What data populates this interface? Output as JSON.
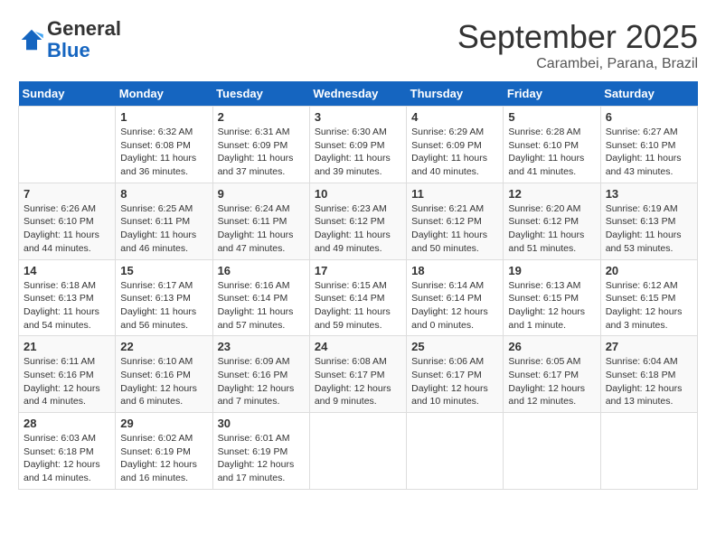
{
  "header": {
    "logo_general": "General",
    "logo_blue": "Blue",
    "month": "September 2025",
    "location": "Carambei, Parana, Brazil"
  },
  "days_of_week": [
    "Sunday",
    "Monday",
    "Tuesday",
    "Wednesday",
    "Thursday",
    "Friday",
    "Saturday"
  ],
  "weeks": [
    [
      {
        "day": "",
        "sunrise": "",
        "sunset": "",
        "daylight": ""
      },
      {
        "day": "1",
        "sunrise": "Sunrise: 6:32 AM",
        "sunset": "Sunset: 6:08 PM",
        "daylight": "Daylight: 11 hours and 36 minutes."
      },
      {
        "day": "2",
        "sunrise": "Sunrise: 6:31 AM",
        "sunset": "Sunset: 6:09 PM",
        "daylight": "Daylight: 11 hours and 37 minutes."
      },
      {
        "day": "3",
        "sunrise": "Sunrise: 6:30 AM",
        "sunset": "Sunset: 6:09 PM",
        "daylight": "Daylight: 11 hours and 39 minutes."
      },
      {
        "day": "4",
        "sunrise": "Sunrise: 6:29 AM",
        "sunset": "Sunset: 6:09 PM",
        "daylight": "Daylight: 11 hours and 40 minutes."
      },
      {
        "day": "5",
        "sunrise": "Sunrise: 6:28 AM",
        "sunset": "Sunset: 6:10 PM",
        "daylight": "Daylight: 11 hours and 41 minutes."
      },
      {
        "day": "6",
        "sunrise": "Sunrise: 6:27 AM",
        "sunset": "Sunset: 6:10 PM",
        "daylight": "Daylight: 11 hours and 43 minutes."
      }
    ],
    [
      {
        "day": "7",
        "sunrise": "Sunrise: 6:26 AM",
        "sunset": "Sunset: 6:10 PM",
        "daylight": "Daylight: 11 hours and 44 minutes."
      },
      {
        "day": "8",
        "sunrise": "Sunrise: 6:25 AM",
        "sunset": "Sunset: 6:11 PM",
        "daylight": "Daylight: 11 hours and 46 minutes."
      },
      {
        "day": "9",
        "sunrise": "Sunrise: 6:24 AM",
        "sunset": "Sunset: 6:11 PM",
        "daylight": "Daylight: 11 hours and 47 minutes."
      },
      {
        "day": "10",
        "sunrise": "Sunrise: 6:23 AM",
        "sunset": "Sunset: 6:12 PM",
        "daylight": "Daylight: 11 hours and 49 minutes."
      },
      {
        "day": "11",
        "sunrise": "Sunrise: 6:21 AM",
        "sunset": "Sunset: 6:12 PM",
        "daylight": "Daylight: 11 hours and 50 minutes."
      },
      {
        "day": "12",
        "sunrise": "Sunrise: 6:20 AM",
        "sunset": "Sunset: 6:12 PM",
        "daylight": "Daylight: 11 hours and 51 minutes."
      },
      {
        "day": "13",
        "sunrise": "Sunrise: 6:19 AM",
        "sunset": "Sunset: 6:13 PM",
        "daylight": "Daylight: 11 hours and 53 minutes."
      }
    ],
    [
      {
        "day": "14",
        "sunrise": "Sunrise: 6:18 AM",
        "sunset": "Sunset: 6:13 PM",
        "daylight": "Daylight: 11 hours and 54 minutes."
      },
      {
        "day": "15",
        "sunrise": "Sunrise: 6:17 AM",
        "sunset": "Sunset: 6:13 PM",
        "daylight": "Daylight: 11 hours and 56 minutes."
      },
      {
        "day": "16",
        "sunrise": "Sunrise: 6:16 AM",
        "sunset": "Sunset: 6:14 PM",
        "daylight": "Daylight: 11 hours and 57 minutes."
      },
      {
        "day": "17",
        "sunrise": "Sunrise: 6:15 AM",
        "sunset": "Sunset: 6:14 PM",
        "daylight": "Daylight: 11 hours and 59 minutes."
      },
      {
        "day": "18",
        "sunrise": "Sunrise: 6:14 AM",
        "sunset": "Sunset: 6:14 PM",
        "daylight": "Daylight: 12 hours and 0 minutes."
      },
      {
        "day": "19",
        "sunrise": "Sunrise: 6:13 AM",
        "sunset": "Sunset: 6:15 PM",
        "daylight": "Daylight: 12 hours and 1 minute."
      },
      {
        "day": "20",
        "sunrise": "Sunrise: 6:12 AM",
        "sunset": "Sunset: 6:15 PM",
        "daylight": "Daylight: 12 hours and 3 minutes."
      }
    ],
    [
      {
        "day": "21",
        "sunrise": "Sunrise: 6:11 AM",
        "sunset": "Sunset: 6:16 PM",
        "daylight": "Daylight: 12 hours and 4 minutes."
      },
      {
        "day": "22",
        "sunrise": "Sunrise: 6:10 AM",
        "sunset": "Sunset: 6:16 PM",
        "daylight": "Daylight: 12 hours and 6 minutes."
      },
      {
        "day": "23",
        "sunrise": "Sunrise: 6:09 AM",
        "sunset": "Sunset: 6:16 PM",
        "daylight": "Daylight: 12 hours and 7 minutes."
      },
      {
        "day": "24",
        "sunrise": "Sunrise: 6:08 AM",
        "sunset": "Sunset: 6:17 PM",
        "daylight": "Daylight: 12 hours and 9 minutes."
      },
      {
        "day": "25",
        "sunrise": "Sunrise: 6:06 AM",
        "sunset": "Sunset: 6:17 PM",
        "daylight": "Daylight: 12 hours and 10 minutes."
      },
      {
        "day": "26",
        "sunrise": "Sunrise: 6:05 AM",
        "sunset": "Sunset: 6:17 PM",
        "daylight": "Daylight: 12 hours and 12 minutes."
      },
      {
        "day": "27",
        "sunrise": "Sunrise: 6:04 AM",
        "sunset": "Sunset: 6:18 PM",
        "daylight": "Daylight: 12 hours and 13 minutes."
      }
    ],
    [
      {
        "day": "28",
        "sunrise": "Sunrise: 6:03 AM",
        "sunset": "Sunset: 6:18 PM",
        "daylight": "Daylight: 12 hours and 14 minutes."
      },
      {
        "day": "29",
        "sunrise": "Sunrise: 6:02 AM",
        "sunset": "Sunset: 6:19 PM",
        "daylight": "Daylight: 12 hours and 16 minutes."
      },
      {
        "day": "30",
        "sunrise": "Sunrise: 6:01 AM",
        "sunset": "Sunset: 6:19 PM",
        "daylight": "Daylight: 12 hours and 17 minutes."
      },
      {
        "day": "",
        "sunrise": "",
        "sunset": "",
        "daylight": ""
      },
      {
        "day": "",
        "sunrise": "",
        "sunset": "",
        "daylight": ""
      },
      {
        "day": "",
        "sunrise": "",
        "sunset": "",
        "daylight": ""
      },
      {
        "day": "",
        "sunrise": "",
        "sunset": "",
        "daylight": ""
      }
    ]
  ]
}
